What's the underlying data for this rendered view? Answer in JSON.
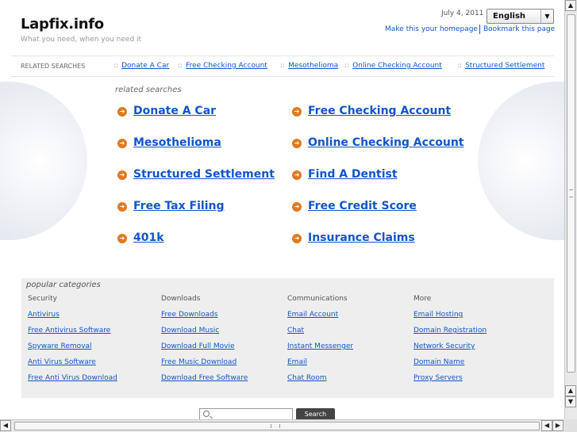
{
  "header": {
    "logo": "Lapfix.info",
    "tagline": "What you need, when you need it",
    "date": "July 4, 2011",
    "language": "English",
    "homepage_link": "Make this your homepage",
    "bookmark_link": "Bookmark this page"
  },
  "related_bar": {
    "label": "RELATED SEARCHES",
    "separator": "::",
    "items": [
      "Donate A Car",
      "Free Checking Account",
      "Mesothelioma",
      "Online Checking Account",
      "Structured Settlement"
    ]
  },
  "related_searches": {
    "heading": "related searches",
    "left": [
      "Donate A Car",
      "Mesothelioma",
      "Structured Settlement",
      "Free Tax Filing",
      "401k"
    ],
    "right": [
      "Free Checking Account",
      "Online Checking Account",
      "Find A Dentist",
      "Free Credit Score",
      "Insurance Claims"
    ]
  },
  "popular": {
    "heading": "popular categories",
    "columns": [
      {
        "title": "Security",
        "links": [
          "Antivirus",
          "Free Antivirus Software",
          "Spyware Removal",
          "Anti Virus Software",
          "Free Anti Virus Download"
        ]
      },
      {
        "title": "Downloads",
        "links": [
          "Free Downloads",
          "Download Music",
          "Download Full Movie",
          "Free Music Download",
          "Download Free Software"
        ]
      },
      {
        "title": "Communications",
        "links": [
          "Email Account",
          "Chat",
          "Instant Messenger",
          "Email",
          "Chat Room"
        ]
      },
      {
        "title": "More",
        "links": [
          "Email Hosting",
          "Domain Registration",
          "Network Security",
          "Domain Name",
          "Proxy Servers"
        ]
      }
    ]
  },
  "search": {
    "button_label": "Search"
  },
  "icons": {
    "search": "magnifier-icon",
    "bullet": "circle-arrow-right-icon",
    "dropdown": "triangle-down-icon"
  },
  "colors": {
    "link": "#1155cc",
    "bullet": "#e07a1f",
    "popular_bg": "#eeeeee"
  }
}
